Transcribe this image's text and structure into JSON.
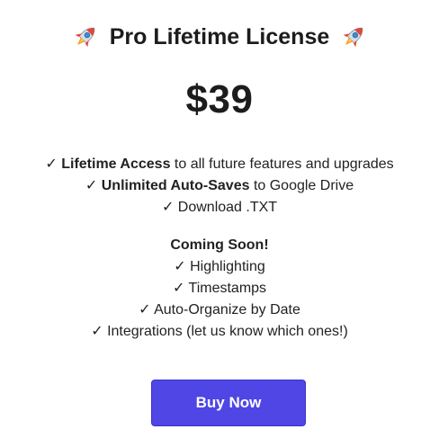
{
  "title": {
    "text": "Pro Lifetime License",
    "left_icon": "rocket-icon",
    "right_icon": "rocket-icon"
  },
  "price": "$39",
  "features": [
    {
      "check": "✓",
      "bold": "Lifetime Access",
      "rest": " to all future features and upgrades"
    },
    {
      "check": "✓",
      "bold": "Unlimited Auto-Saves",
      "rest": " to Google Drive"
    },
    {
      "check": "✓",
      "bold": "",
      "rest": "Download .TXT"
    }
  ],
  "coming_soon": {
    "heading": "Coming Soon!",
    "items": [
      {
        "check": "✓",
        "text": "Highlighting"
      },
      {
        "check": "✓",
        "text": "Timestamps"
      },
      {
        "check": "✓",
        "text": "Auto-Organize by Date"
      },
      {
        "check": "✓",
        "text": "Integrations (let us know which ones!)"
      }
    ]
  },
  "button": {
    "label": "Buy Now",
    "color": "#4f46e5"
  }
}
